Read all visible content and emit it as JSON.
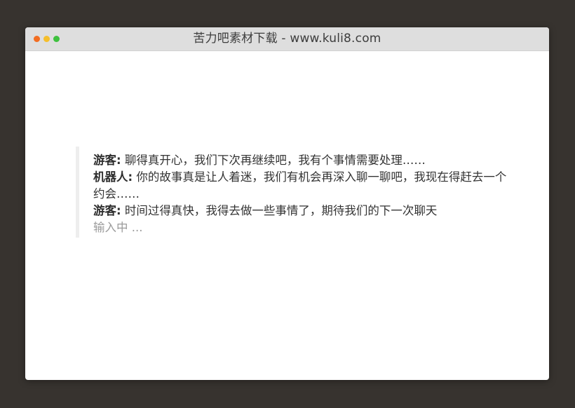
{
  "window": {
    "title": "苦力吧素材下载 - www.kuli8.com",
    "controls": {
      "close_color": "#f26d21",
      "minimize_color": "#f5be2b",
      "maximize_color": "#3ec13e"
    }
  },
  "chat": {
    "messages": [
      {
        "speaker": "游客:",
        "text": "聊得真开心，我们下次再继续吧，我有个事情需要处理……"
      },
      {
        "speaker": "机器人:",
        "text": "你的故事真是让人着迷，我们有机会再深入聊一聊吧，我现在得赶去一个约会……"
      },
      {
        "speaker": "游客:",
        "text": "时间过得真快，我得去做一些事情了，期待我们的下一次聊天"
      }
    ],
    "typing_indicator": "输入中 ..."
  }
}
